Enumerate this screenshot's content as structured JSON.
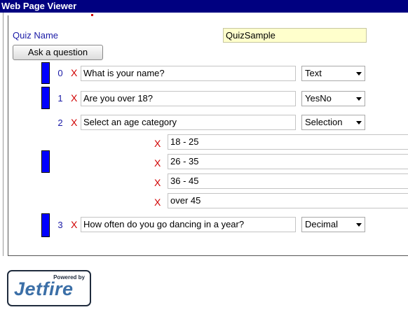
{
  "window": {
    "title": "Web Page Viewer"
  },
  "quiz": {
    "name_label": "Quiz Name",
    "name_value": "QuizSample"
  },
  "toolbar": {
    "ask_label": "Ask a question"
  },
  "icons": {
    "delete": "X"
  },
  "questions": [
    {
      "index": "0",
      "text": "What is your name?",
      "type": "Text"
    },
    {
      "index": "1",
      "text": "Are you over 18?",
      "type": "YesNo"
    },
    {
      "index": "2",
      "text": "Select an age category",
      "type": "Selection",
      "options": [
        "18 - 25",
        "26 - 35",
        "36 - 45",
        "over 45"
      ]
    },
    {
      "index": "3",
      "text": "How often do you go dancing in a year?",
      "type": "Decimal"
    }
  ],
  "logo": {
    "powered": "Powered by",
    "brand": "Jetfire"
  },
  "colors": {
    "titlebar": "#000080",
    "bar": "#0000ff",
    "delete": "#d00000",
    "label": "#1a1aa6",
    "name_field_bg": "#ffffcc"
  }
}
